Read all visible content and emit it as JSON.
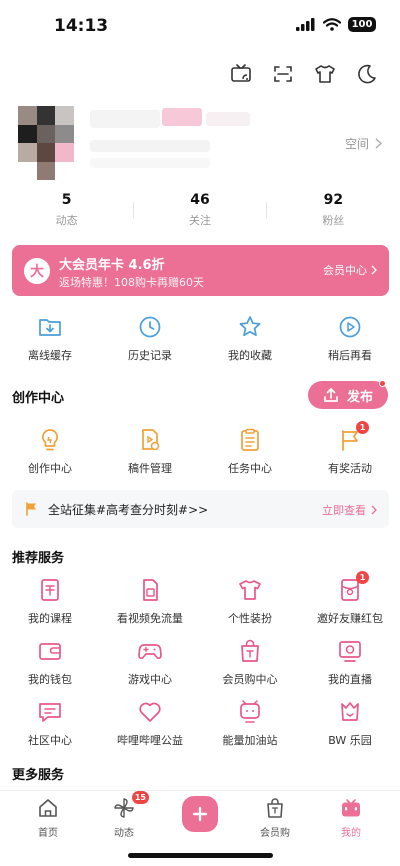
{
  "status_bar": {
    "time": "14:13",
    "battery": "100"
  },
  "top_bar": {
    "icons": [
      "cast-icon",
      "scan-icon",
      "theme-shirt-icon",
      "night-mode-icon"
    ]
  },
  "profile": {
    "space_link": "空间"
  },
  "stats": [
    {
      "value": "5",
      "label": "动态"
    },
    {
      "value": "46",
      "label": "关注"
    },
    {
      "value": "92",
      "label": "粉丝"
    }
  ],
  "vip_banner": {
    "badge": "大",
    "title": "大会员年卡 4.6折",
    "subtitle": "返场特惠！108购卡再赠60天",
    "link": "会员中心"
  },
  "quick_actions": [
    {
      "label": "离线缓存",
      "icon": "download-folder-icon"
    },
    {
      "label": "历史记录",
      "icon": "history-clock-icon"
    },
    {
      "label": "我的收藏",
      "icon": "star-icon"
    },
    {
      "label": "稍后再看",
      "icon": "watch-later-icon"
    }
  ],
  "creation": {
    "title": "创作中心",
    "publish_label": "发布",
    "items": [
      {
        "label": "创作中心",
        "icon": "bulb-icon"
      },
      {
        "label": "稿件管理",
        "icon": "manuscript-icon"
      },
      {
        "label": "任务中心",
        "icon": "clipboard-icon"
      },
      {
        "label": "有奖活动",
        "icon": "flag-icon",
        "badge": "1"
      }
    ]
  },
  "notice": {
    "text": "全站征集#高考查分时刻#>>",
    "link": "立即查看"
  },
  "services": {
    "title": "推荐服务",
    "items": [
      {
        "label": "我的课程",
        "icon": "course-icon"
      },
      {
        "label": "看视频免流量",
        "icon": "sim-card-icon"
      },
      {
        "label": "个性装扮",
        "icon": "tshirt-icon"
      },
      {
        "label": "邀好友赚红包",
        "icon": "red-packet-icon",
        "badge": "1"
      },
      {
        "label": "我的钱包",
        "icon": "wallet-icon"
      },
      {
        "label": "游戏中心",
        "icon": "gamepad-icon"
      },
      {
        "label": "会员购中心",
        "icon": "shopping-bag-icon"
      },
      {
        "label": "我的直播",
        "icon": "live-tv-icon"
      },
      {
        "label": "社区中心",
        "icon": "community-chat-icon"
      },
      {
        "label": "哔哩哔哩公益",
        "icon": "heart-charity-icon"
      },
      {
        "label": "能量加油站",
        "icon": "energy-station-icon"
      },
      {
        "label": "BW 乐园",
        "icon": "bw-park-icon"
      }
    ]
  },
  "more_services": {
    "title": "更多服务"
  },
  "tab_bar": {
    "tabs": [
      {
        "label": "首页",
        "icon": "home-icon"
      },
      {
        "label": "动态",
        "icon": "pinwheel-icon",
        "badge": "15"
      },
      {
        "label": "",
        "icon": "plus-icon"
      },
      {
        "label": "会员购",
        "icon": "shopping-bag-icon"
      },
      {
        "label": "我的",
        "icon": "tv-face-icon"
      }
    ],
    "active": "我的"
  },
  "colors": {
    "accent": "#ec6f96",
    "badge": "#f04545",
    "icon_blue": "#4a9fdc",
    "icon_orange": "#f0a13a",
    "icon_pink": "#e8588a"
  }
}
